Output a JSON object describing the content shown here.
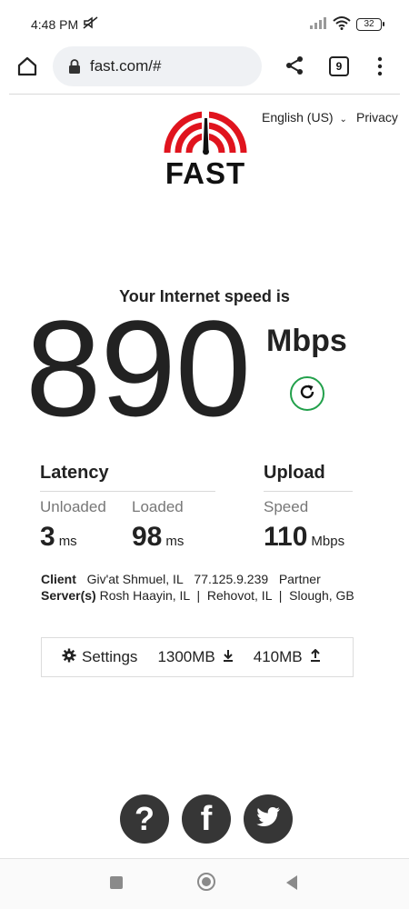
{
  "status_bar": {
    "time": "4:48 PM",
    "battery": "32",
    "icons": [
      "mute-icon",
      "signal-icon",
      "wifi-icon",
      "battery-icon"
    ]
  },
  "browser": {
    "url": "fast.com/#",
    "tab_count": "9",
    "icons": [
      "home-icon",
      "lock-icon",
      "share-icon",
      "tabs-icon",
      "more-icon"
    ]
  },
  "header": {
    "language": "English (US)",
    "privacy": "Privacy",
    "logo_text": "FAST"
  },
  "speed": {
    "caption": "Your Internet speed is",
    "value": "890",
    "unit": "Mbps"
  },
  "latency": {
    "title": "Latency",
    "unloaded_label": "Unloaded",
    "unloaded_value": "3",
    "unloaded_unit": "ms",
    "loaded_label": "Loaded",
    "loaded_value": "98",
    "loaded_unit": "ms"
  },
  "upload": {
    "title": "Upload",
    "speed_label": "Speed",
    "speed_value": "110",
    "speed_unit": "Mbps"
  },
  "client": {
    "label": "Client",
    "location": "Giv'at Shmuel, IL",
    "ip": "77.125.9.239",
    "isp": "Partner"
  },
  "servers": {
    "label": "Server(s)",
    "list": "Rosh Haayin, IL  |  Rehovot, IL  |  Slough, GB"
  },
  "settings_bar": {
    "settings_label": "Settings",
    "download_size": "1300MB",
    "upload_size": "410MB"
  },
  "colors": {
    "accent_red": "#e0141e",
    "refresh_green": "#22a04b",
    "social_bg": "#363636"
  }
}
